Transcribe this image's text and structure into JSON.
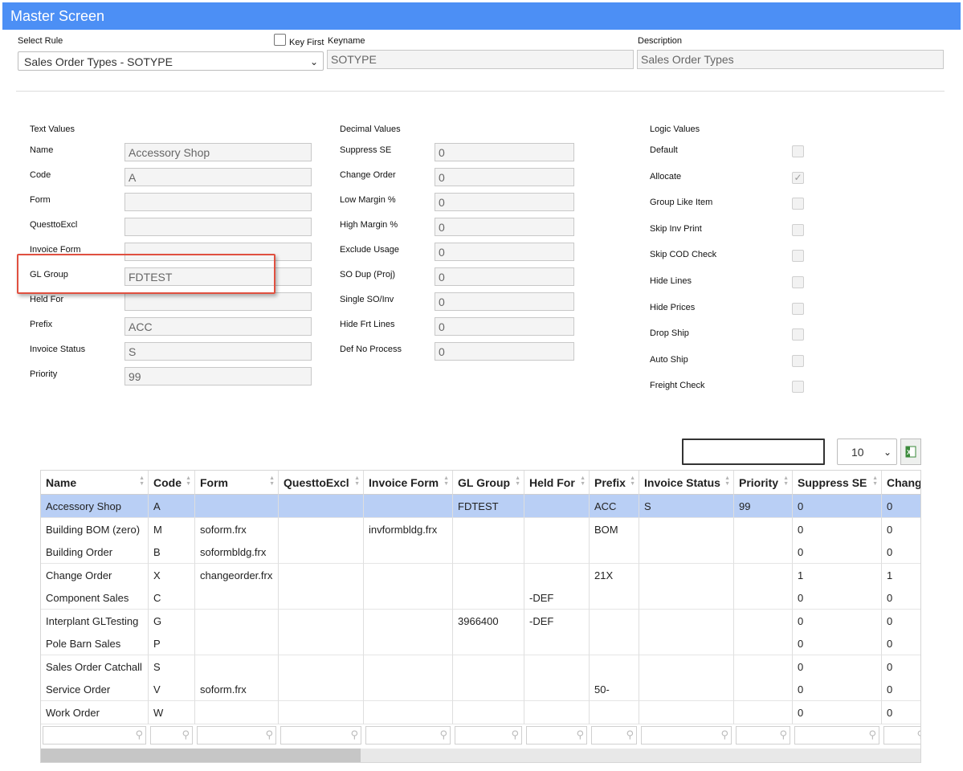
{
  "window": {
    "title": "Master Screen"
  },
  "header": {
    "select_rule_label": "Select Rule",
    "select_rule_value": "Sales Order Types - SOTYPE",
    "key_first_label": "Key First",
    "keyname_label": "Keyname",
    "keyname_value": "SOTYPE",
    "description_label": "Description",
    "description_value": "Sales Order Types"
  },
  "text_values": {
    "heading": "Text Values",
    "fields": [
      {
        "label": "Name",
        "value": "Accessory Shop"
      },
      {
        "label": "Code",
        "value": "A"
      },
      {
        "label": "Form",
        "value": ""
      },
      {
        "label": "QuesttoExcl",
        "value": ""
      },
      {
        "label": "Invoice Form",
        "value": ""
      },
      {
        "label": "GL Group",
        "value": "FDTEST"
      },
      {
        "label": "Held For",
        "value": ""
      },
      {
        "label": "Prefix",
        "value": "ACC"
      },
      {
        "label": "Invoice Status",
        "value": "S"
      },
      {
        "label": "Priority",
        "value": "99"
      }
    ]
  },
  "decimal_values": {
    "heading": "Decimal Values",
    "fields": [
      {
        "label": "Suppress SE",
        "value": "0"
      },
      {
        "label": "Change Order",
        "value": "0"
      },
      {
        "label": "Low Margin %",
        "value": "0"
      },
      {
        "label": "High Margin %",
        "value": "0"
      },
      {
        "label": "Exclude Usage",
        "value": "0"
      },
      {
        "label": "SO Dup (Proj)",
        "value": "0"
      },
      {
        "label": "Single SO/Inv",
        "value": "0"
      },
      {
        "label": "Hide Frt Lines",
        "value": "0"
      },
      {
        "label": "Def No Process",
        "value": "0"
      }
    ]
  },
  "logic_values": {
    "heading": "Logic Values",
    "fields": [
      {
        "label": "Default",
        "checked": false
      },
      {
        "label": "Allocate",
        "checked": true
      },
      {
        "label": "Group Like Item",
        "checked": false
      },
      {
        "label": "Skip Inv Print",
        "checked": false
      },
      {
        "label": "Skip COD Check",
        "checked": false
      },
      {
        "label": "Hide Lines",
        "checked": false
      },
      {
        "label": "Hide Prices",
        "checked": false
      },
      {
        "label": "Drop Ship",
        "checked": false
      },
      {
        "label": "Auto Ship",
        "checked": false
      },
      {
        "label": "Freight Check",
        "checked": false
      }
    ]
  },
  "grid_toolbar": {
    "search_value": "",
    "page_size": "10",
    "export_icon": "excel-export-icon"
  },
  "grid": {
    "columns": [
      "Name",
      "Code",
      "Form",
      "QuesttoExcl",
      "Invoice Form",
      "GL Group",
      "Held For",
      "Prefix",
      "Invoice Status",
      "Priority",
      "Suppress SE",
      "Change Order"
    ],
    "rows": [
      [
        "Accessory Shop",
        "A",
        "",
        "",
        "",
        "FDTEST",
        "",
        "ACC",
        "S",
        "99",
        "0",
        "0"
      ],
      [
        "Building BOM (zero)",
        "M",
        "soform.frx",
        "",
        "invformbldg.frx",
        "",
        "",
        "BOM",
        "",
        "",
        "0",
        "0"
      ],
      [
        "Building Order",
        "B",
        "soformbldg.frx",
        "",
        "",
        "",
        "",
        "",
        "",
        "",
        "0",
        "0"
      ],
      [
        "Change Order",
        "X",
        "changeorder.frx",
        "",
        "",
        "",
        "",
        "21X",
        "",
        "",
        "1",
        "1"
      ],
      [
        "Component Sales",
        "C",
        "",
        "",
        "",
        "",
        "-DEF",
        "",
        "",
        "",
        "0",
        "0"
      ],
      [
        "Interplant GLTesting",
        "G",
        "",
        "",
        "",
        "3966400",
        "-DEF",
        "",
        "",
        "",
        "0",
        "0"
      ],
      [
        "Pole Barn Sales",
        "P",
        "",
        "",
        "",
        "",
        "",
        "",
        "",
        "",
        "0",
        "0"
      ],
      [
        "Sales Order Catchall",
        "S",
        "",
        "",
        "",
        "",
        "",
        "",
        "",
        "",
        "0",
        "0"
      ],
      [
        "Service Order",
        "V",
        "soform.frx",
        "",
        "",
        "",
        "",
        "50-",
        "",
        "",
        "0",
        "0"
      ],
      [
        "Work Order",
        "W",
        "",
        "",
        "",
        "",
        "",
        "",
        "",
        "",
        "0",
        "0"
      ]
    ],
    "selected_row": 0
  },
  "colors": {
    "titlebar": "#4c8ff5",
    "selected_row": "#b9cff5",
    "highlight_box": "#e05040"
  }
}
